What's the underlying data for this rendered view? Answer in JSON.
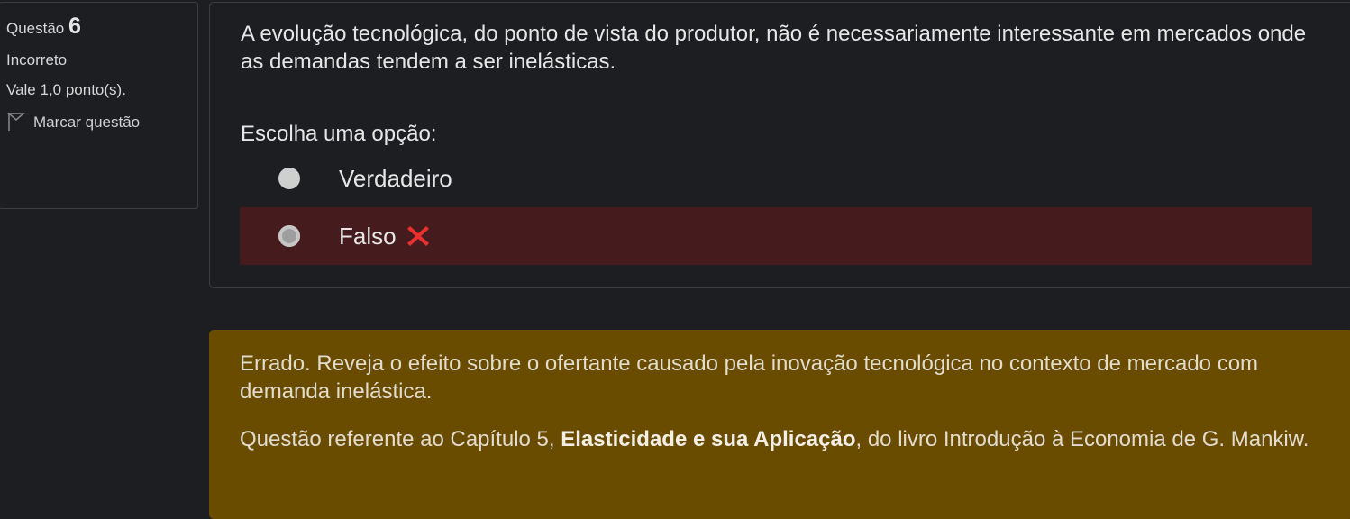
{
  "info": {
    "question_label": "Questão",
    "question_number": "6",
    "state": "Incorreto",
    "grade": "Vale 1,0 ponto(s).",
    "flag_label": "Marcar questão",
    "flag_icon": "flag-icon"
  },
  "question": {
    "text": "A evolução tecnológica, do ponto de vista do produtor, não é necessariamente interessante em mercados onde as demandas tendem a ser inelásticas.",
    "prompt": "Escolha uma opção:",
    "options": [
      {
        "label": "Verdadeiro",
        "selected": false
      },
      {
        "label": "Falso",
        "selected": true,
        "status": "incorrect"
      }
    ],
    "incorrect_icon": "cross-icon"
  },
  "feedback": {
    "paragraph1": "Errado. Reveja o efeito sobre o ofertante causado pela inovação tecnológica no contexto de mercado com demanda inelástica.",
    "paragraph2_prefix": "Questão referente ao Capítulo 5, ",
    "paragraph2_bold": "Elasticidade e sua Aplicação",
    "paragraph2_suffix": ", do livro Introdução à Economia de G. Mankiw."
  },
  "colors": {
    "background": "#1d1e22",
    "incorrect_row": "#451b1e",
    "feedback_bg": "#6a4c01",
    "cross": "#e8312f"
  }
}
